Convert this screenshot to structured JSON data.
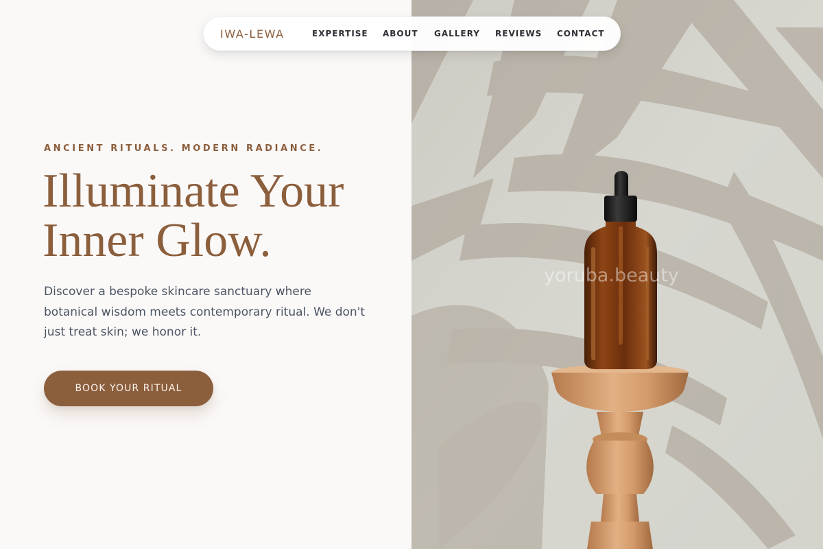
{
  "nav": {
    "brand": "IWA-LEWA",
    "links": [
      "EXPERTISE",
      "ABOUT",
      "GALLERY",
      "REVIEWS",
      "CONTACT"
    ]
  },
  "hero": {
    "eyebrow": "ANCIENT RITUALS. MODERN RADIANCE.",
    "headline_line1": "Illuminate Your",
    "headline_line2": "Inner Glow.",
    "description": "Discover a bespoke skincare sanctuary where botanical wisdom meets contemporary ritual. We don't just treat skin; we honor it.",
    "cta_label": "BOOK YOUR RITUAL",
    "image_watermark": "yoruba.beauty"
  },
  "colors": {
    "accent": "#8b5e3c",
    "page_bg": "#fbf9f8",
    "body_text": "#4b5563",
    "nav_text": "#2f2f36",
    "image_wall": "#d2d3cc"
  },
  "icons": [
    "serum-bottle-image"
  ]
}
